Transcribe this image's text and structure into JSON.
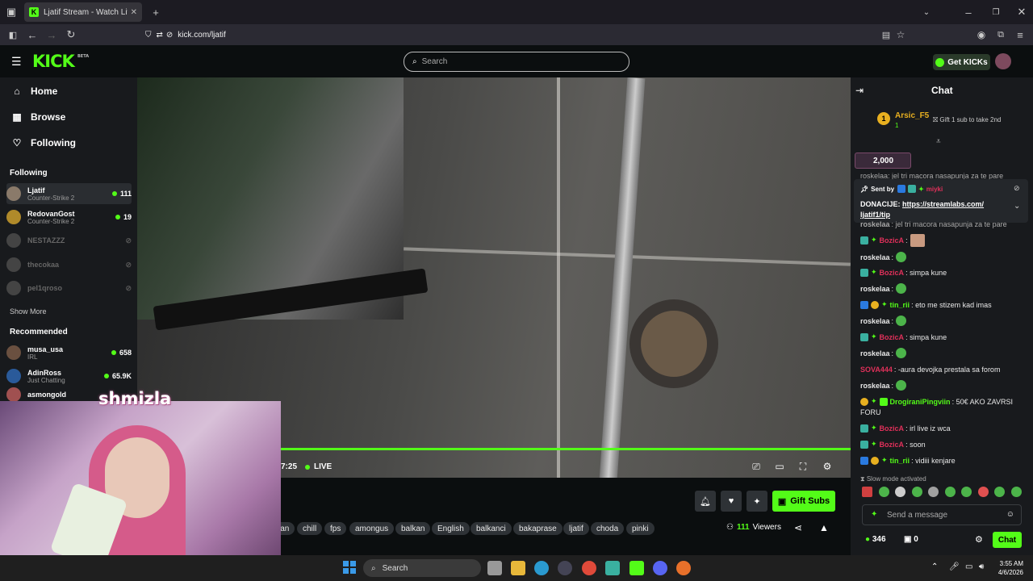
{
  "browser": {
    "tab_title": "Ljatif Stream - Watch Live o",
    "url": "kick.com/ljatif"
  },
  "header": {
    "logo": "KICK",
    "beta": "BETA",
    "search_placeholder": "Search",
    "get_kicks": "Get KICKs"
  },
  "sidebar": {
    "nav": [
      {
        "label": "Home",
        "icon": "home-icon"
      },
      {
        "label": "Browse",
        "icon": "browse-icon"
      },
      {
        "label": "Following",
        "icon": "heart-icon"
      }
    ],
    "following_title": "Following",
    "following": [
      {
        "name": "Ljatif",
        "game": "Counter-Strike 2",
        "viewers": "111",
        "live": true
      },
      {
        "name": "RedovanGost",
        "game": "Counter-Strike 2",
        "viewers": "19",
        "live": true
      },
      {
        "name": "NESTAZZZ",
        "game": "",
        "viewers": "",
        "live": false
      },
      {
        "name": "thecokaa",
        "game": "",
        "viewers": "",
        "live": false
      },
      {
        "name": "pel1qroso",
        "game": "",
        "viewers": "",
        "live": false
      }
    ],
    "show_more": "Show More",
    "recommended_title": "Recommended",
    "recommended": [
      {
        "name": "musa_usa",
        "game": "IRL",
        "viewers": "658"
      },
      {
        "name": "AdinRoss",
        "game": "Just Chatting",
        "viewers": "65.9K"
      },
      {
        "name": "asmongold",
        "game": "",
        "viewers": ""
      }
    ]
  },
  "webcam": {
    "overlay_name": "shmizla"
  },
  "player": {
    "time": "7:25",
    "live": "LIVE",
    "progress": 1.0
  },
  "below": {
    "tags": [
      "ian",
      "chill",
      "fps",
      "amongus",
      "balkan",
      "English",
      "balkanci",
      "bakaprase",
      "ljatif",
      "choda",
      "pinki"
    ],
    "gift_subs": "Gift Subs",
    "viewers_count": "111",
    "viewers_label": "Viewers"
  },
  "chat": {
    "title": "Chat",
    "gifter": {
      "name": "Arsic_F5",
      "count": "1",
      "rank": "1"
    },
    "gift_prompt": "Gift 1 sub to take 2nd",
    "kicks_amount": "2,000",
    "pinned_sent_by": "Sent by",
    "pinned_sender": "miyki",
    "pinned_text": "DONACIJE:",
    "pinned_link": "https://streamlabs.com/ljatif1/tip",
    "pinned_link_a": "https://streamlabs.com/",
    "pinned_link_b": "ljatif1/tip",
    "scroll_top_text": "roskelaa: jel tri macora nasapunja za te pare",
    "messages": [
      {
        "user": "roskelaa",
        "text": "jel tri macora nasapunja za te pare",
        "color": "#e8e8e8"
      },
      {
        "user": "BozicA",
        "text": "",
        "color": "#e0305a"
      },
      {
        "user": "roskelaa",
        "text": "",
        "color": "#e8e8e8"
      },
      {
        "user": "BozicA",
        "text": "simpa kune",
        "color": "#e0305a"
      },
      {
        "user": "roskelaa",
        "text": "",
        "color": "#e8e8e8"
      },
      {
        "user": "tin_rii",
        "text": "eto me stizem kad imas",
        "color": "#53fc18"
      },
      {
        "user": "roskelaa",
        "text": "",
        "color": "#e8e8e8"
      },
      {
        "user": "BozicA",
        "text": "simpa kune",
        "color": "#e0305a"
      },
      {
        "user": "roskelaa",
        "text": "",
        "color": "#e8e8e8"
      },
      {
        "user": "SOVA444",
        "text": "-aura devojka prestala sa forom",
        "color": "#e0305a"
      },
      {
        "user": "roskelaa",
        "text": "",
        "color": "#e8e8e8"
      },
      {
        "user": "DrogiraniPingviin",
        "text": "50€ AKO ZAVRSI",
        "color": "#53fc18"
      },
      {
        "user": "",
        "text": "FORU",
        "color": "#e8e8e8"
      },
      {
        "user": "BozicA",
        "text": "irl live iz wca",
        "color": "#e0305a"
      },
      {
        "user": "BozicA",
        "text": "soon",
        "color": "#e0305a"
      },
      {
        "user": "tin_rii",
        "text": "vidiii kenjare",
        "color": "#53fc18"
      }
    ],
    "slow_mode": "Slow mode activated",
    "input_placeholder": "Send a message",
    "kicks_balance": "346",
    "subs_count": "0",
    "send": "Chat"
  },
  "taskbar": {
    "search": "Search",
    "time": "3:55 AM",
    "date": "4/6/2026"
  },
  "colors": {
    "accent": "#53fc18",
    "bg": "#0b0e0f",
    "panel": "#181a1d"
  }
}
